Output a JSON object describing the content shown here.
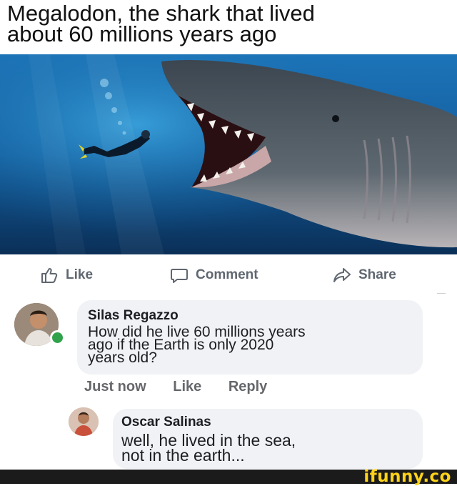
{
  "caption": {
    "line1": "Megalodon, the shark that lived",
    "line2": "about 60 millions years ago"
  },
  "actions": {
    "like": "Like",
    "comment": "Comment",
    "share": "Share"
  },
  "comments": [
    {
      "author": "Silas Regazzo",
      "text": "How did he live 60 millions years\nago if the Earth is only 2020\nyears old?",
      "timestamp": "Just now",
      "like_label": "Like",
      "reply_label": "Reply",
      "online": true
    },
    {
      "author": "Oscar Salinas",
      "text": "well, he lived in the sea,\nnot in the earth..."
    }
  ],
  "footer": {
    "brand": "ifunny.co"
  },
  "colors": {
    "ocean_light": "#2d8fc8",
    "ocean_dark": "#0a2f57",
    "bubble_bg": "#f0f2f5",
    "online": "#31a24c",
    "brand": "#ffd31a"
  }
}
